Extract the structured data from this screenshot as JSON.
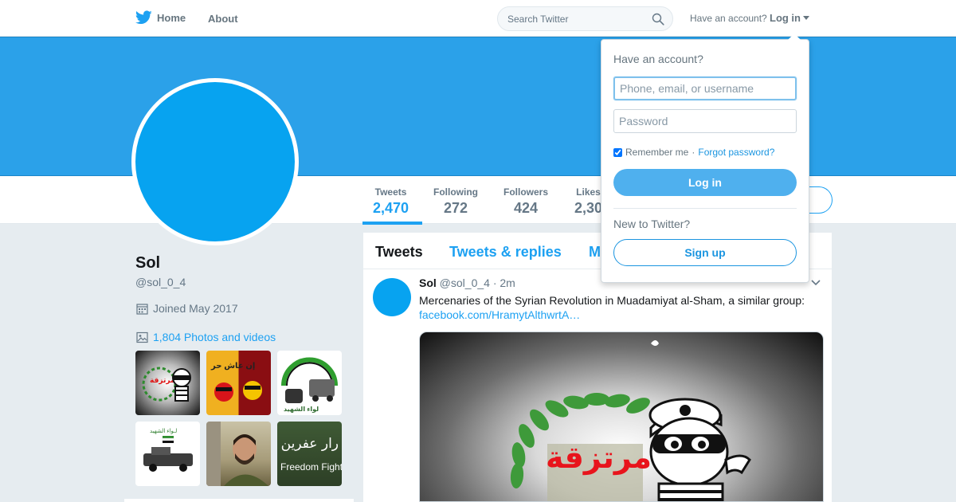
{
  "nav": {
    "home_label": "Home",
    "about_label": "About",
    "search_placeholder": "Search Twitter",
    "account_prompt": "Have an account?",
    "login_label": "Log in"
  },
  "profile": {
    "name": "Sol",
    "handle": "@sol_0_4",
    "joined": "Joined May 2017",
    "photos_label": "1,804 Photos and videos",
    "avatar_color": "#07a3f0",
    "banner_color": "#2ba1e9",
    "thumbnails": [
      {
        "icon": "robber-cartoon-thumbnail"
      },
      {
        "icon": "red-cartoon-thumbnail"
      },
      {
        "icon": "brigade-logo-thumbnail"
      },
      {
        "icon": "vehicles-flag-thumbnail"
      },
      {
        "icon": "man-portrait-thumbnail"
      },
      {
        "icon": "freedom-fighters-thumbnail"
      }
    ],
    "thumb_texts": {
      "freedom_fighters": "Freedom Fighte",
      "afrin": "رار عفرين"
    }
  },
  "stats": [
    {
      "label": "Tweets",
      "value": "2,470"
    },
    {
      "label": "Following",
      "value": "272"
    },
    {
      "label": "Followers",
      "value": "424"
    },
    {
      "label": "Likes",
      "value": "2,30"
    }
  ],
  "timeline": {
    "tabs": [
      "Tweets",
      "Tweets & replies",
      "M"
    ],
    "tweet": {
      "name": "Sol",
      "handle": "@sol_0_4",
      "separator": "·",
      "time": "2m",
      "text": "Mercenaries of the Syrian Revolution in Muadamiyat al-Sham, a similar group:",
      "link": "facebook.com/HramytAlthwrtA…",
      "media_overlay_text": "مرتزقة"
    }
  },
  "login_dropdown": {
    "title": "Have an account?",
    "username_placeholder": "Phone, email, or username",
    "password_placeholder": "Password",
    "remember_label": "Remember me",
    "separator": "·",
    "forgot_label": "Forgot password?",
    "login_button": "Log in",
    "new_prompt": "New to Twitter?",
    "signup_button": "Sign up"
  },
  "colors": {
    "accent": "#1da1f2",
    "login_button": "#4fb0ee"
  }
}
